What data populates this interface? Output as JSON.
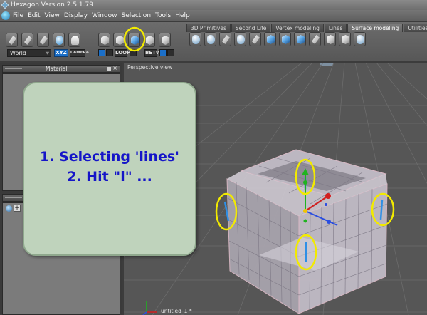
{
  "window": {
    "title": "Hexagon Version 2.5.1.79"
  },
  "menu": {
    "items": [
      "File",
      "Edit",
      "View",
      "Display",
      "Window",
      "Selection",
      "Tools",
      "Help"
    ]
  },
  "toolbar": {
    "world_label": "World",
    "xyz_label": "XYZ",
    "camera_label": "CAMERA",
    "loop_label": "LOOP",
    "betw_label": "BETW"
  },
  "tabs": [
    {
      "label": "3D Primitives",
      "active": false
    },
    {
      "label": "Second Life",
      "active": false
    },
    {
      "label": "Vertex modeling",
      "active": false
    },
    {
      "label": "Lines",
      "active": false
    },
    {
      "label": "Surface modeling",
      "active": true
    },
    {
      "label": "Utilities",
      "active": false
    }
  ],
  "panels": {
    "material_title": "Material"
  },
  "viewport": {
    "title": "Perspective view",
    "file_label": "untitled_1 *"
  },
  "callout": {
    "line1": "1. Selecting 'lines'",
    "line2": "2. Hit \"l\" ..."
  },
  "colors": {
    "highlight_ring": "#f2ea00",
    "callout_bg": "#bfd3bc",
    "callout_text": "#1515c8",
    "active_tab": "#7b7b7b"
  }
}
